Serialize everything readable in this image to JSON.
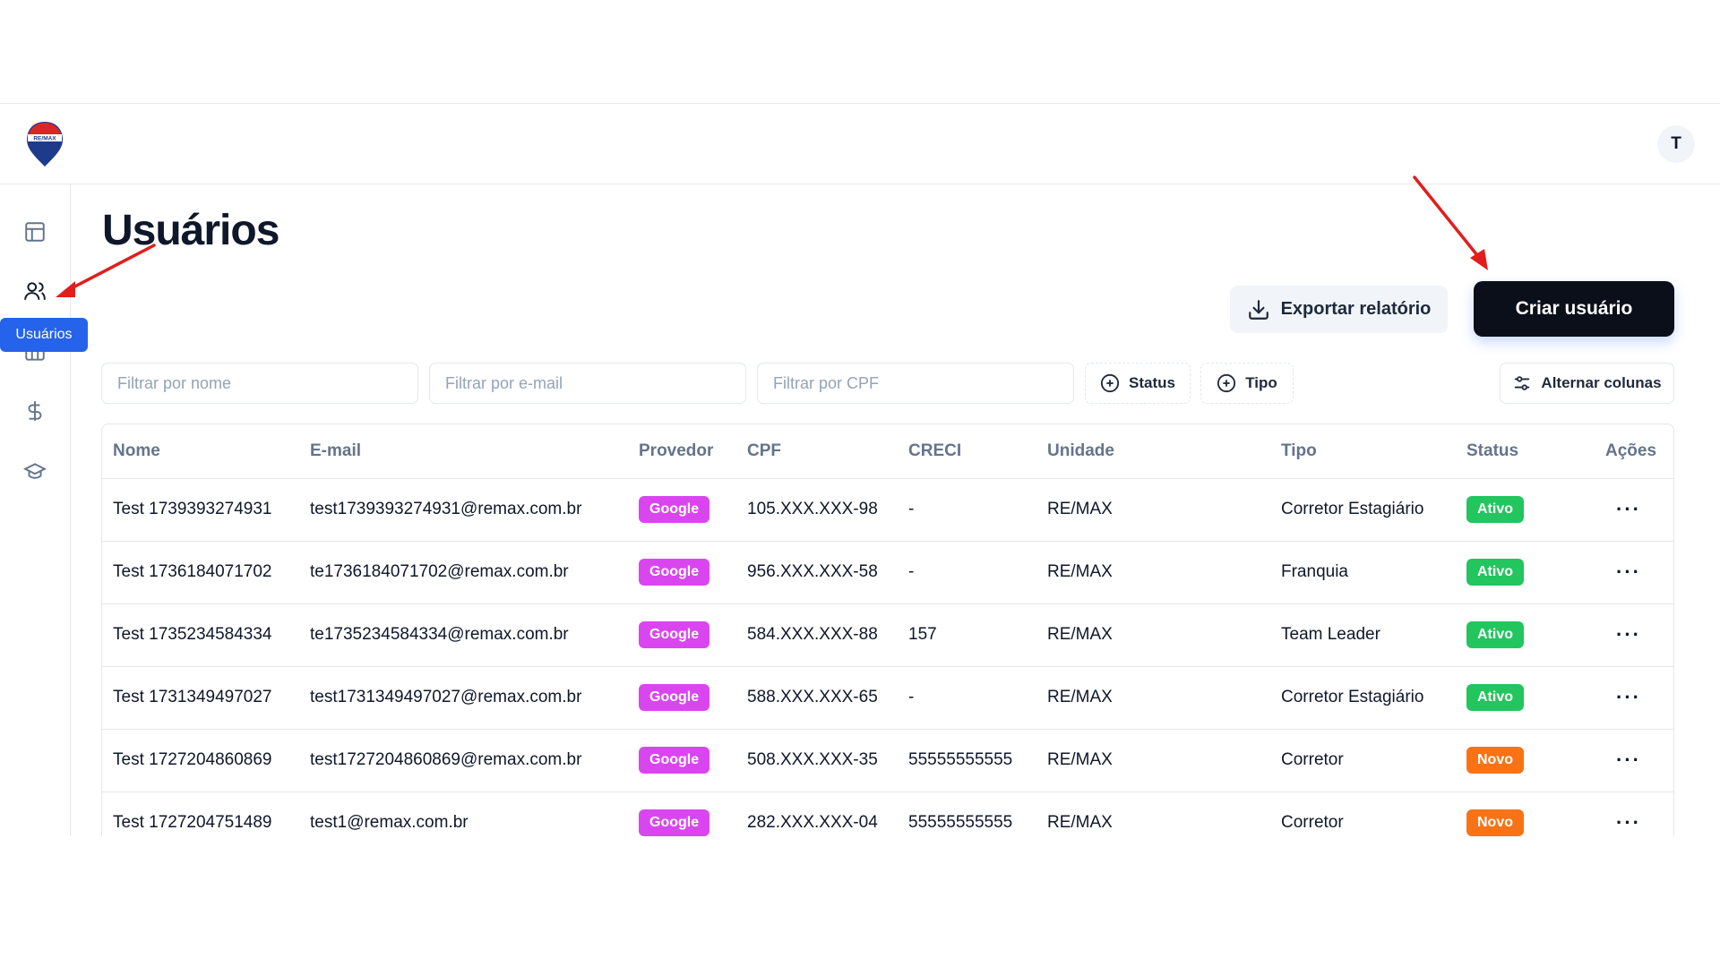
{
  "header": {
    "logo_text": "RE/MAX",
    "avatar_initial": "T"
  },
  "sidebar": {
    "items": [
      {
        "name": "dashboard",
        "icon": "layout-icon"
      },
      {
        "name": "users",
        "icon": "users-icon"
      },
      {
        "name": "units",
        "icon": "building-icon"
      },
      {
        "name": "finance",
        "icon": "dollar-icon"
      },
      {
        "name": "education",
        "icon": "graduation-cap-icon"
      }
    ],
    "tooltip": "Usuários"
  },
  "page": {
    "title": "Usuários"
  },
  "toolbar": {
    "export_label": "Exportar relatório",
    "create_label": "Criar usuário"
  },
  "filters": {
    "name_placeholder": "Filtrar por nome",
    "email_placeholder": "Filtrar por e-mail",
    "cpf_placeholder": "Filtrar por CPF",
    "status_label": "Status",
    "type_label": "Tipo",
    "columns_label": "Alternar colunas"
  },
  "table": {
    "headers": [
      "Nome",
      "E-mail",
      "Provedor",
      "CPF",
      "CRECI",
      "Unidade",
      "Tipo",
      "Status",
      "Ações"
    ],
    "rows": [
      {
        "nome": "Test 1739393274931",
        "email": "test1739393274931@remax.com.br",
        "provedor": "Google",
        "cpf": "105.XXX.XXX-98",
        "creci": "-",
        "unidade": "RE/MAX",
        "tipo": "Corretor Estagiário",
        "status": "Ativo"
      },
      {
        "nome": "Test 1736184071702",
        "email": "te1736184071702@remax.com.br",
        "provedor": "Google",
        "cpf": "956.XXX.XXX-58",
        "creci": "-",
        "unidade": "RE/MAX",
        "tipo": "Franquia",
        "status": "Ativo"
      },
      {
        "nome": "Test 1735234584334",
        "email": "te1735234584334@remax.com.br",
        "provedor": "Google",
        "cpf": "584.XXX.XXX-88",
        "creci": "157",
        "unidade": "RE/MAX",
        "tipo": "Team Leader",
        "status": "Ativo"
      },
      {
        "nome": "Test 1731349497027",
        "email": "test1731349497027@remax.com.br",
        "provedor": "Google",
        "cpf": "588.XXX.XXX-65",
        "creci": "-",
        "unidade": "RE/MAX",
        "tipo": "Corretor Estagiário",
        "status": "Ativo"
      },
      {
        "nome": "Test 1727204860869",
        "email": "test1727204860869@remax.com.br",
        "provedor": "Google",
        "cpf": "508.XXX.XXX-35",
        "creci": "55555555555",
        "unidade": "RE/MAX",
        "tipo": "Corretor",
        "status": "Novo"
      },
      {
        "nome": "Test 1727204751489",
        "email": "test1@remax.com.br",
        "provedor": "Google",
        "cpf": "282.XXX.XXX-04",
        "creci": "55555555555",
        "unidade": "RE/MAX",
        "tipo": "Corretor",
        "status": "Novo"
      }
    ],
    "actions_glyph": "···"
  },
  "colors": {
    "ativo": "#22c55e",
    "novo": "#f97316",
    "google": "#d946ef",
    "primary": "#0b0f19",
    "tooltip": "#2563eb",
    "annotation_arrow": "#e11d1d"
  }
}
